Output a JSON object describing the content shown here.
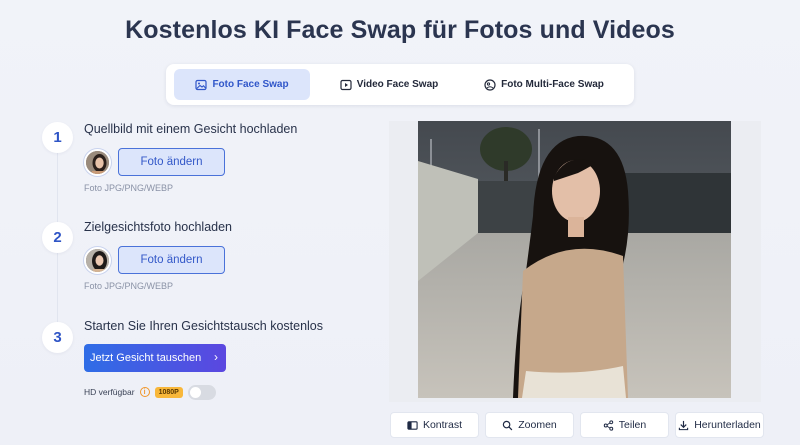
{
  "page": {
    "title": "Kostenlos KI Face Swap für Fotos und Videos"
  },
  "tabs": [
    {
      "label": "Foto Face Swap",
      "icon": "image-icon",
      "active": true
    },
    {
      "label": "Video Face Swap",
      "icon": "video-icon",
      "active": false
    },
    {
      "label": "Foto Multi-Face Swap",
      "icon": "multi-face-icon",
      "active": false
    }
  ],
  "steps": [
    {
      "number": "1",
      "title": "Quellbild mit einem Gesicht hochladen",
      "button": "Foto ändern",
      "formats": "Foto JPG/PNG/WEBP"
    },
    {
      "number": "2",
      "title": "Zielgesichtsfoto hochladen",
      "button": "Foto ändern",
      "formats": "Foto JPG/PNG/WEBP"
    },
    {
      "number": "3",
      "title": "Starten Sie Ihren Gesichtstausch kostenlos"
    }
  ],
  "swap_button": {
    "label": "Jetzt Gesicht tauschen",
    "chevron": "›"
  },
  "hd": {
    "label": "HD verfügbar",
    "info": "i",
    "badge": "1080P",
    "enabled": false
  },
  "actions": [
    {
      "label": "Kontrast",
      "icon": "compare-icon"
    },
    {
      "label": "Zoomen",
      "icon": "search-icon"
    },
    {
      "label": "Teilen",
      "icon": "share-icon"
    },
    {
      "label": "Herunterladen",
      "icon": "download-icon"
    }
  ],
  "colors": {
    "accent": "#3056c9",
    "tab_active_bg": "#dce5fb",
    "badge": "#f8b73a",
    "gradient_start": "#2f6de6",
    "gradient_end": "#5b47e0"
  }
}
